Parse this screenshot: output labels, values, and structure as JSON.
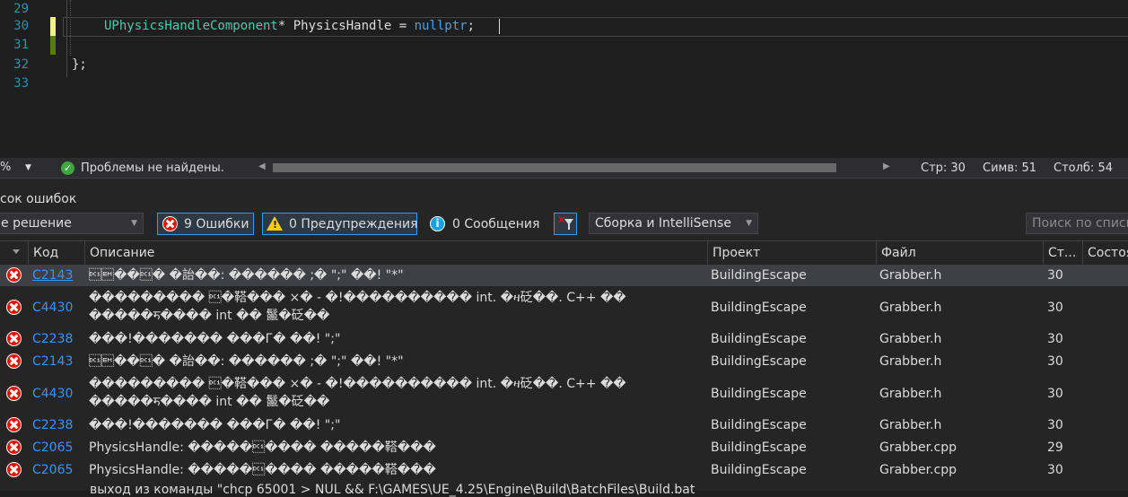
{
  "editor": {
    "lines": [
      {
        "number": "29",
        "tokens": []
      },
      {
        "number": "30",
        "tokens": [
          {
            "cls": "type",
            "text": "UPhysicsHandleComponent"
          },
          {
            "cls": "plain",
            "text": "* PhysicsHandle = "
          },
          {
            "cls": "kw",
            "text": "nullptr"
          },
          {
            "cls": "plain",
            "text": ";"
          }
        ]
      },
      {
        "number": "31",
        "tokens": []
      },
      {
        "number": "32",
        "tokens": [
          {
            "cls": "plain",
            "text": "};"
          }
        ]
      },
      {
        "number": "33",
        "tokens": []
      }
    ]
  },
  "status": {
    "zoom": "%",
    "issues_text": "Проблемы не найдены.",
    "line": "Стр: 30",
    "char": "Симв: 51",
    "col": "Столб: 54"
  },
  "error_list": {
    "title": "сок ошибок",
    "scope": "е решение",
    "errors_label": "9 Ошибки",
    "warnings_label": "0 Предупреждения",
    "messages_label": "0 Сообщения",
    "build_filter": "Сборка и IntelliSense",
    "search_placeholder": "Поиск по списк",
    "columns": {
      "code": "Код",
      "description": "Описание",
      "project": "Проект",
      "file": "Файл",
      "line": "Ст...",
      "state": "Состоя"
    },
    "rows": [
      {
        "code": "C2143",
        "desc": [
          "\u0011\u0019��\u0011� �詒��: ������ ;� \";\" ��! \"*\""
        ],
        "project": "BuildingEscape",
        "file": "Grabber.h",
        "line": "30"
      },
      {
        "code": "C4430",
        "desc": [
          "��������� \u0011�鞳��� ×� - �!���������� int. �ዛ砭��. C++ ��",
          "�����ॸ���� int �� 鬣�砭��"
        ],
        "project": "BuildingEscape",
        "file": "Grabber.h",
        "line": "30"
      },
      {
        "code": "C2238",
        "desc": [
          "���!������� ���Г� ��! \";\""
        ],
        "project": "BuildingEscape",
        "file": "Grabber.h",
        "line": "30"
      },
      {
        "code": "C2143",
        "desc": [
          "\u0011\u0019��\u0011� �詒��: ������ ;� \";\" ��! \"*\""
        ],
        "project": "BuildingEscape",
        "file": "Grabber.h",
        "line": "30"
      },
      {
        "code": "C4430",
        "desc": [
          "��������� \u0011�鞳��� ×� - �!���������� int. �ዛ砭��. C++ ��",
          "�����ॸ���� int �� 鬣�砭��"
        ],
        "project": "BuildingEscape",
        "file": "Grabber.h",
        "line": "30"
      },
      {
        "code": "C2238",
        "desc": [
          "���!������� ���Г� ��! \";\""
        ],
        "project": "BuildingEscape",
        "file": "Grabber.h",
        "line": "30"
      },
      {
        "code": "C2065",
        "desc": [
          "PhysicsHandle: �����\u0011���� �����鞳���"
        ],
        "project": "BuildingEscape",
        "file": "Grabber.cpp",
        "line": "29"
      },
      {
        "code": "C2065",
        "desc": [
          "PhysicsHandle: �����\u0011���� �����鞳���"
        ],
        "project": "BuildingEscape",
        "file": "Grabber.cpp",
        "line": "30"
      }
    ],
    "cut_row_text": "выход из команды \"chcp 65001 > NUL && F:\\GAMES\\UE_4.25\\Engine\\Build\\BatchFiles\\Build.bat"
  }
}
